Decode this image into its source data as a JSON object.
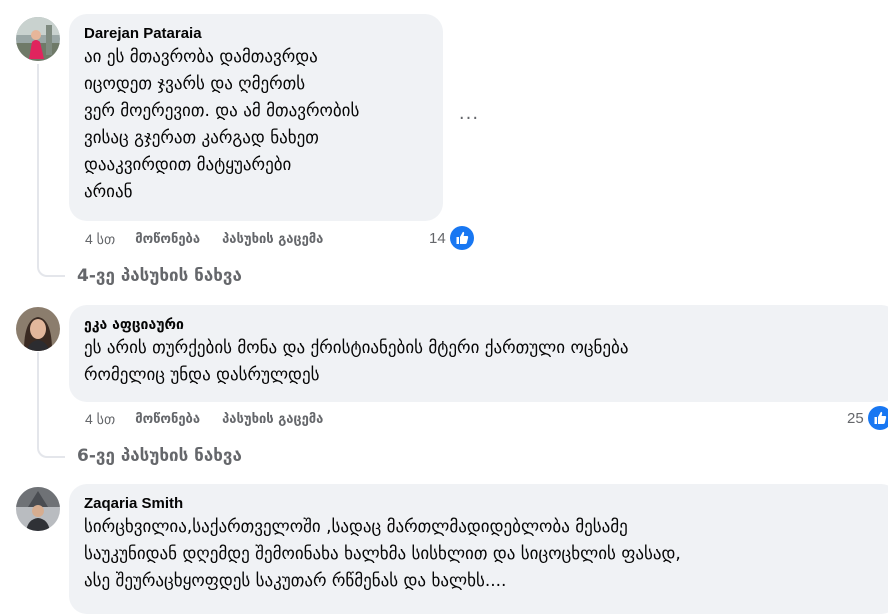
{
  "comments": [
    {
      "author": "Darejan Pataraia",
      "text": "აი ეს მთავრობა დამთავრდა\nიცოდეთ ჯვარს და ღმერთს\nვერ მოერევით. და ამ მთავრობის\nვისაც გჯერათ კარგად ნახეთ\nდააკვირდით მატყუარები\nარიან",
      "time": "4 სთ",
      "like_label": "მოწონება",
      "reply_label": "პასუხის გაცემა",
      "reaction_count": "14",
      "view_replies": "4-ვე პასუხის ნახვა",
      "more_icon": "···"
    },
    {
      "author": "ეკა აფციაური",
      "text": "ეს არის თურქების მონა და ქრისტიანების მტერი ქართული ოცნება\nრომელიც უნდა დასრულდეს",
      "time": "4 სთ",
      "like_label": "მოწონება",
      "reply_label": "პასუხის გაცემა",
      "reaction_count": "25",
      "view_replies": "6-ვე პასუხის ნახვა"
    },
    {
      "author": "Zaqaria Smith",
      "text": "სირცხვილია,საქართველოში ,სადაც მართლმადიდებლობა მესამე\nსაუკუნიდან დღემდე შემოინახა ხალხმა სისხლით და სიცოცხლის ფასად,\nასე შეურაცხყოფდეს საკუთარ რწმენას და ხალხს...."
    }
  ],
  "colors": {
    "bubble": "#f0f2f5",
    "muted_text": "#65676b",
    "like_blue": "#1877f2",
    "thread_line": "#e4e6eb"
  },
  "icons": {
    "like": "like-thumbs-up-icon",
    "more": "more-options-icon"
  }
}
